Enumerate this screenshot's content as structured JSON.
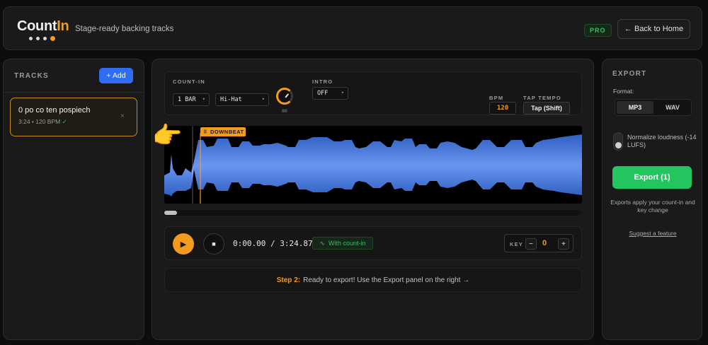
{
  "header": {
    "logo_main": "Count",
    "logo_accent": "In",
    "tagline": "Stage-ready backing tracks",
    "pro_badge": "PRO",
    "home_button": "← Back to Home"
  },
  "tracks": {
    "title": "TRACKS",
    "add_button": "+ Add",
    "items": [
      {
        "name": "0 po co ten pospiech",
        "meta": "3:24 • 120 BPM",
        "status_icon": "✓",
        "remove_icon": "×"
      }
    ]
  },
  "controls": {
    "countin_label": "COUNT-IN",
    "bars_value": "1 BAR",
    "sound_value": "Hi-Hat",
    "volume_value": "80",
    "intro_label": "INTRO",
    "intro_value": "OFF",
    "bpm_label": "BPM",
    "bpm_value": "120",
    "tap_label": "TAP TEMPO",
    "tap_button": "Tap (Shift)"
  },
  "waveform": {
    "marker_label": "DOWNBEAT",
    "pointer_emoji": "👉",
    "colors": {
      "wave": "#3f73d8",
      "marker": "#f39b1f"
    }
  },
  "transport": {
    "current_time": "0:00.00",
    "total_time": "3:24.87",
    "countin_badge": "With count-in",
    "key_label": "KEY",
    "key_value": "0",
    "key_minus": "−",
    "key_plus": "+"
  },
  "step": {
    "prefix": "Step 2:",
    "text": "Ready to export! Use the Export panel on the right →"
  },
  "export": {
    "title": "EXPORT",
    "format_label": "Format:",
    "formats": [
      "MP3",
      "WAV"
    ],
    "selected_format": "MP3",
    "normalize_label": "Normalize loudness (-14 LUFS)",
    "normalize_on": false,
    "export_button": "Export (1)",
    "note": "Exports apply your count-in and key change",
    "suggest_link": "Suggest a feature"
  }
}
